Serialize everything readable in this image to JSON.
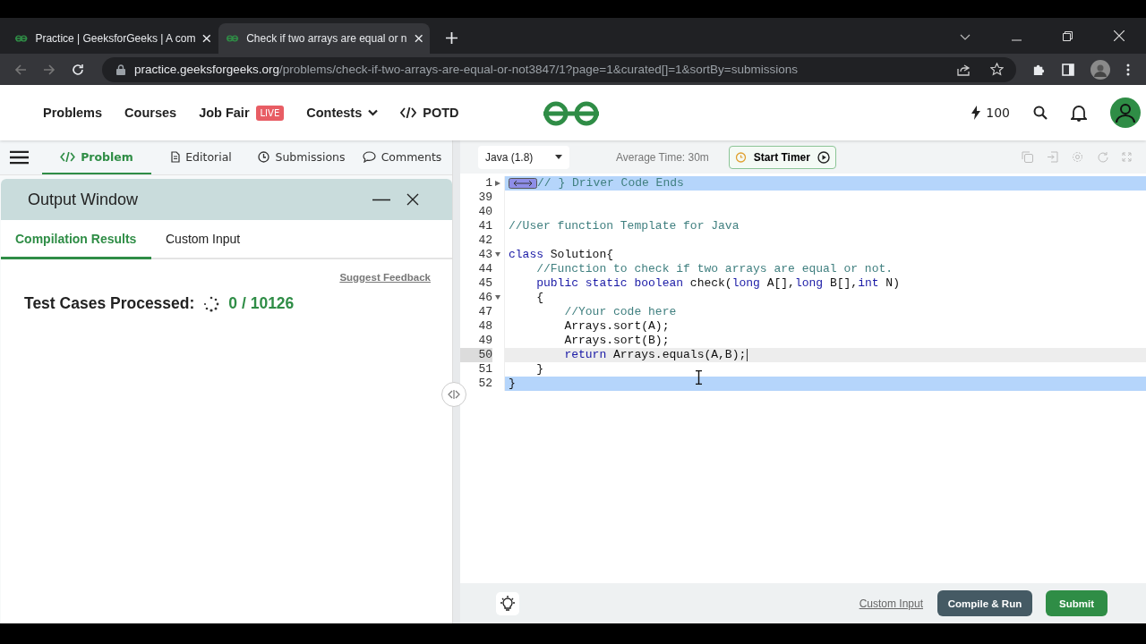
{
  "browser": {
    "tabs": [
      {
        "title": "Practice | GeeksforGeeks | A com",
        "selected": false
      },
      {
        "title": "Check if two arrays are equal or n",
        "selected": true
      }
    ],
    "url_host": "practice.geeksforgeeks.org",
    "url_path": "/problems/check-if-two-arrays-are-equal-or-not3847/1?page=1&curated[]=1&sortBy=submissions"
  },
  "site_nav": {
    "items": [
      {
        "label": "Problems",
        "kind": "link"
      },
      {
        "label": "Courses",
        "kind": "link"
      },
      {
        "label": "Job Fair",
        "kind": "badge",
        "badge": "LIVE"
      },
      {
        "label": "Contests",
        "kind": "dropdown"
      },
      {
        "label": "POTD",
        "kind": "code"
      }
    ],
    "score": "100"
  },
  "problem_tabs": [
    {
      "label": "Problem",
      "selected": true
    },
    {
      "label": "Editorial",
      "selected": false
    },
    {
      "label": "Submissions",
      "selected": false
    },
    {
      "label": "Comments",
      "selected": false
    }
  ],
  "output_window": {
    "title": "Output Window",
    "tabs": [
      {
        "label": "Compilation Results",
        "selected": true
      },
      {
        "label": "Custom Input",
        "selected": false
      }
    ],
    "feedback_link": "Suggest Feedback",
    "processed_label": "Test Cases Processed:",
    "progress": "0 / 10126"
  },
  "editor": {
    "language": "Java (1.8)",
    "average_time": "Average Time: 30m",
    "timer_button": "Start Timer",
    "lines": [
      {
        "number": "1",
        "folded": true,
        "foldable": true,
        "highlighted": true,
        "active": false,
        "tokens": [
          {
            "kind": "comment",
            "text": "// } Driver Code Ends"
          }
        ]
      },
      {
        "number": "39",
        "folded": false,
        "foldable": false,
        "highlighted": false,
        "active": false
      },
      {
        "number": "40",
        "folded": false,
        "foldable": false,
        "highlighted": false,
        "active": false
      },
      {
        "number": "41",
        "folded": false,
        "foldable": false,
        "highlighted": false,
        "active": false,
        "tokens": [
          {
            "kind": "comment",
            "text": "//User function Template for Java"
          }
        ]
      },
      {
        "number": "42",
        "folded": false,
        "foldable": false,
        "highlighted": false,
        "active": false
      },
      {
        "number": "43",
        "folded": false,
        "foldable": true,
        "highlighted": false,
        "active": false,
        "tokens": [
          {
            "kind": "keyword",
            "text": "class"
          },
          {
            "kind": "plain",
            "text": " Solution{"
          }
        ]
      },
      {
        "number": "44",
        "folded": false,
        "foldable": false,
        "highlighted": false,
        "active": false,
        "tokens": [
          {
            "kind": "comment",
            "text": "    //Function to check if two arrays are equal or not."
          }
        ]
      },
      {
        "number": "45",
        "folded": false,
        "foldable": false,
        "highlighted": false,
        "active": false,
        "tokens": [
          {
            "kind": "keyword",
            "text": "    public static boolean"
          },
          {
            "kind": "plain",
            "text": " check("
          },
          {
            "kind": "keyword",
            "text": "long"
          },
          {
            "kind": "plain",
            "text": " A[],"
          },
          {
            "kind": "keyword",
            "text": "long"
          },
          {
            "kind": "plain",
            "text": " B[],"
          },
          {
            "kind": "keyword",
            "text": "int"
          },
          {
            "kind": "plain",
            "text": " N)"
          }
        ]
      },
      {
        "number": "46",
        "folded": false,
        "foldable": true,
        "highlighted": false,
        "active": false,
        "tokens": [
          {
            "kind": "plain",
            "text": "    {"
          }
        ]
      },
      {
        "number": "47",
        "folded": false,
        "foldable": false,
        "highlighted": false,
        "active": false,
        "tokens": [
          {
            "kind": "comment",
            "text": "        //Your code here"
          }
        ]
      },
      {
        "number": "48",
        "folded": false,
        "foldable": false,
        "highlighted": false,
        "active": false,
        "tokens": [
          {
            "kind": "plain",
            "text": "        Arrays.sort(A);"
          }
        ]
      },
      {
        "number": "49",
        "folded": false,
        "foldable": false,
        "highlighted": false,
        "active": false,
        "tokens": [
          {
            "kind": "plain",
            "text": "        Arrays.sort(B);"
          }
        ]
      },
      {
        "number": "50",
        "folded": false,
        "foldable": false,
        "highlighted": false,
        "active": true,
        "tokens": [
          {
            "kind": "keyword",
            "text": "        return"
          },
          {
            "kind": "plain",
            "text": " Arrays.equals(A,B);"
          }
        ]
      },
      {
        "number": "51",
        "folded": false,
        "foldable": false,
        "highlighted": false,
        "active": false,
        "tokens": [
          {
            "kind": "plain",
            "text": "    }"
          }
        ]
      },
      {
        "number": "52",
        "folded": false,
        "foldable": false,
        "highlighted": true,
        "active": false,
        "tokens": [
          {
            "kind": "plain",
            "text": "}"
          }
        ]
      }
    ]
  },
  "footer": {
    "custom_input_link": "Custom Input",
    "compile_button": "Compile & Run",
    "submit_button": "Submit"
  }
}
